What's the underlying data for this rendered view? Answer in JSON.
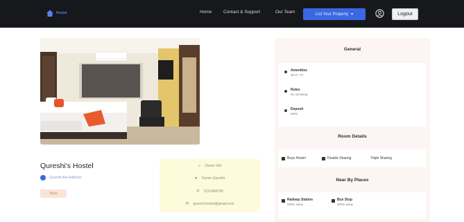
{
  "navbar": {
    "logo_text": "Hostel",
    "links": [
      "Home",
      "Contact & Support",
      "Our Team"
    ],
    "properties_button": "List Your Property",
    "logout": "Logout"
  },
  "hostel": {
    "name": "Qureshi's Hostel",
    "location": "Qureshi Ave Address",
    "tag": "Boys"
  },
  "contact": {
    "items": [
      {
        "icon": "house-icon",
        "text": "Owner Info"
      },
      {
        "icon": "person-icon",
        "text": "Owner Qureshi"
      },
      {
        "icon": "phone-icon",
        "text": "9123456789"
      },
      {
        "icon": "mail-icon",
        "text": "qureshi.hostel@gmail.com"
      }
    ]
  },
  "general": {
    "title": "General",
    "items": [
      {
        "label": "Amenities",
        "value": "Wi-Fi, TV"
      },
      {
        "label": "Rules",
        "value": "No Smoking"
      },
      {
        "label": "Deposit",
        "value": "5000"
      }
    ]
  },
  "room_details": {
    "title": "Room Details",
    "items": [
      "Boys Hostel",
      "Double Sharing",
      "Triple Sharing"
    ]
  },
  "near_places": {
    "title": "Near By Places",
    "items": [
      {
        "label": "Railway Station",
        "value": "500m away"
      },
      {
        "label": "Bus Stop",
        "value": "300m away"
      }
    ]
  },
  "colors": {
    "navbar": "#16181c",
    "accent": "#3c67e3",
    "side_panel": "#fdf5f3",
    "contact_card": "#fefbdb"
  }
}
